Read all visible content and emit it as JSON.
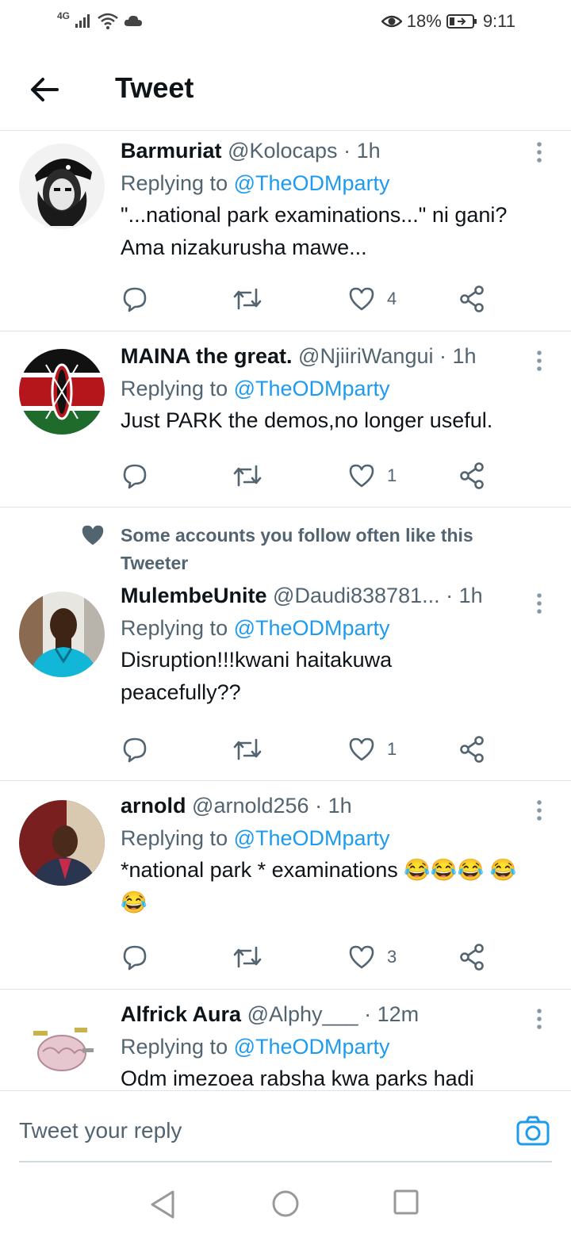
{
  "status": {
    "network": "4G",
    "battery": "18%",
    "time": "9:11"
  },
  "header": {
    "title": "Tweet"
  },
  "social_context": "Some accounts you follow often like this Tweeter",
  "tweets": [
    {
      "name": "Barmuriat",
      "handle": "@Kolocaps",
      "dot": "·",
      "time": "1h",
      "replying_label": "Replying to",
      "replying_to": "@TheODMparty",
      "text": "\"...national park examinations...\" ni gani? Ama nizakurusha mawe...",
      "likes": "4"
    },
    {
      "name": "MAINA the great.",
      "handle": "@NjiiriWangui",
      "dot": "·",
      "time": "1h",
      "replying_label": "Replying to",
      "replying_to": "@TheODMparty",
      "text": "Just PARK the demos,no longer useful.",
      "likes": "1"
    },
    {
      "name": "MulembeUnite",
      "handle": "@Daudi838781...",
      "dot": "·",
      "time": "1h",
      "replying_label": "Replying to",
      "replying_to": "@TheODMparty",
      "text": "Disruption!!!kwani haitakuwa peacefully??",
      "likes": "1"
    },
    {
      "name": "arnold",
      "handle": "@arnold256",
      "dot": "·",
      "time": "1h",
      "replying_label": "Replying to",
      "replying_to": "@TheODMparty",
      "text": "*national park * examinations 😂😂😂 😂😂",
      "likes": "3"
    },
    {
      "name": "Alfrick Aura",
      "handle": "@Alphy___",
      "dot": "·",
      "time": "12m",
      "replying_label": "Replying to",
      "replying_to": "@TheODMparty",
      "text": "Odm imezoea rabsha kwa parks hadi",
      "likes": ""
    }
  ],
  "reply_box": {
    "placeholder": "Tweet your reply"
  },
  "colors": {
    "accent": "#1d9bf0",
    "muted": "#536471",
    "divider": "#dfe3e6"
  },
  "icons": [
    "back-arrow-icon",
    "more-icon",
    "reply-icon",
    "retweet-icon",
    "like-icon",
    "share-icon",
    "heart-filled-icon",
    "camera-icon",
    "nav-back-icon",
    "nav-home-icon",
    "nav-recents-icon"
  ]
}
